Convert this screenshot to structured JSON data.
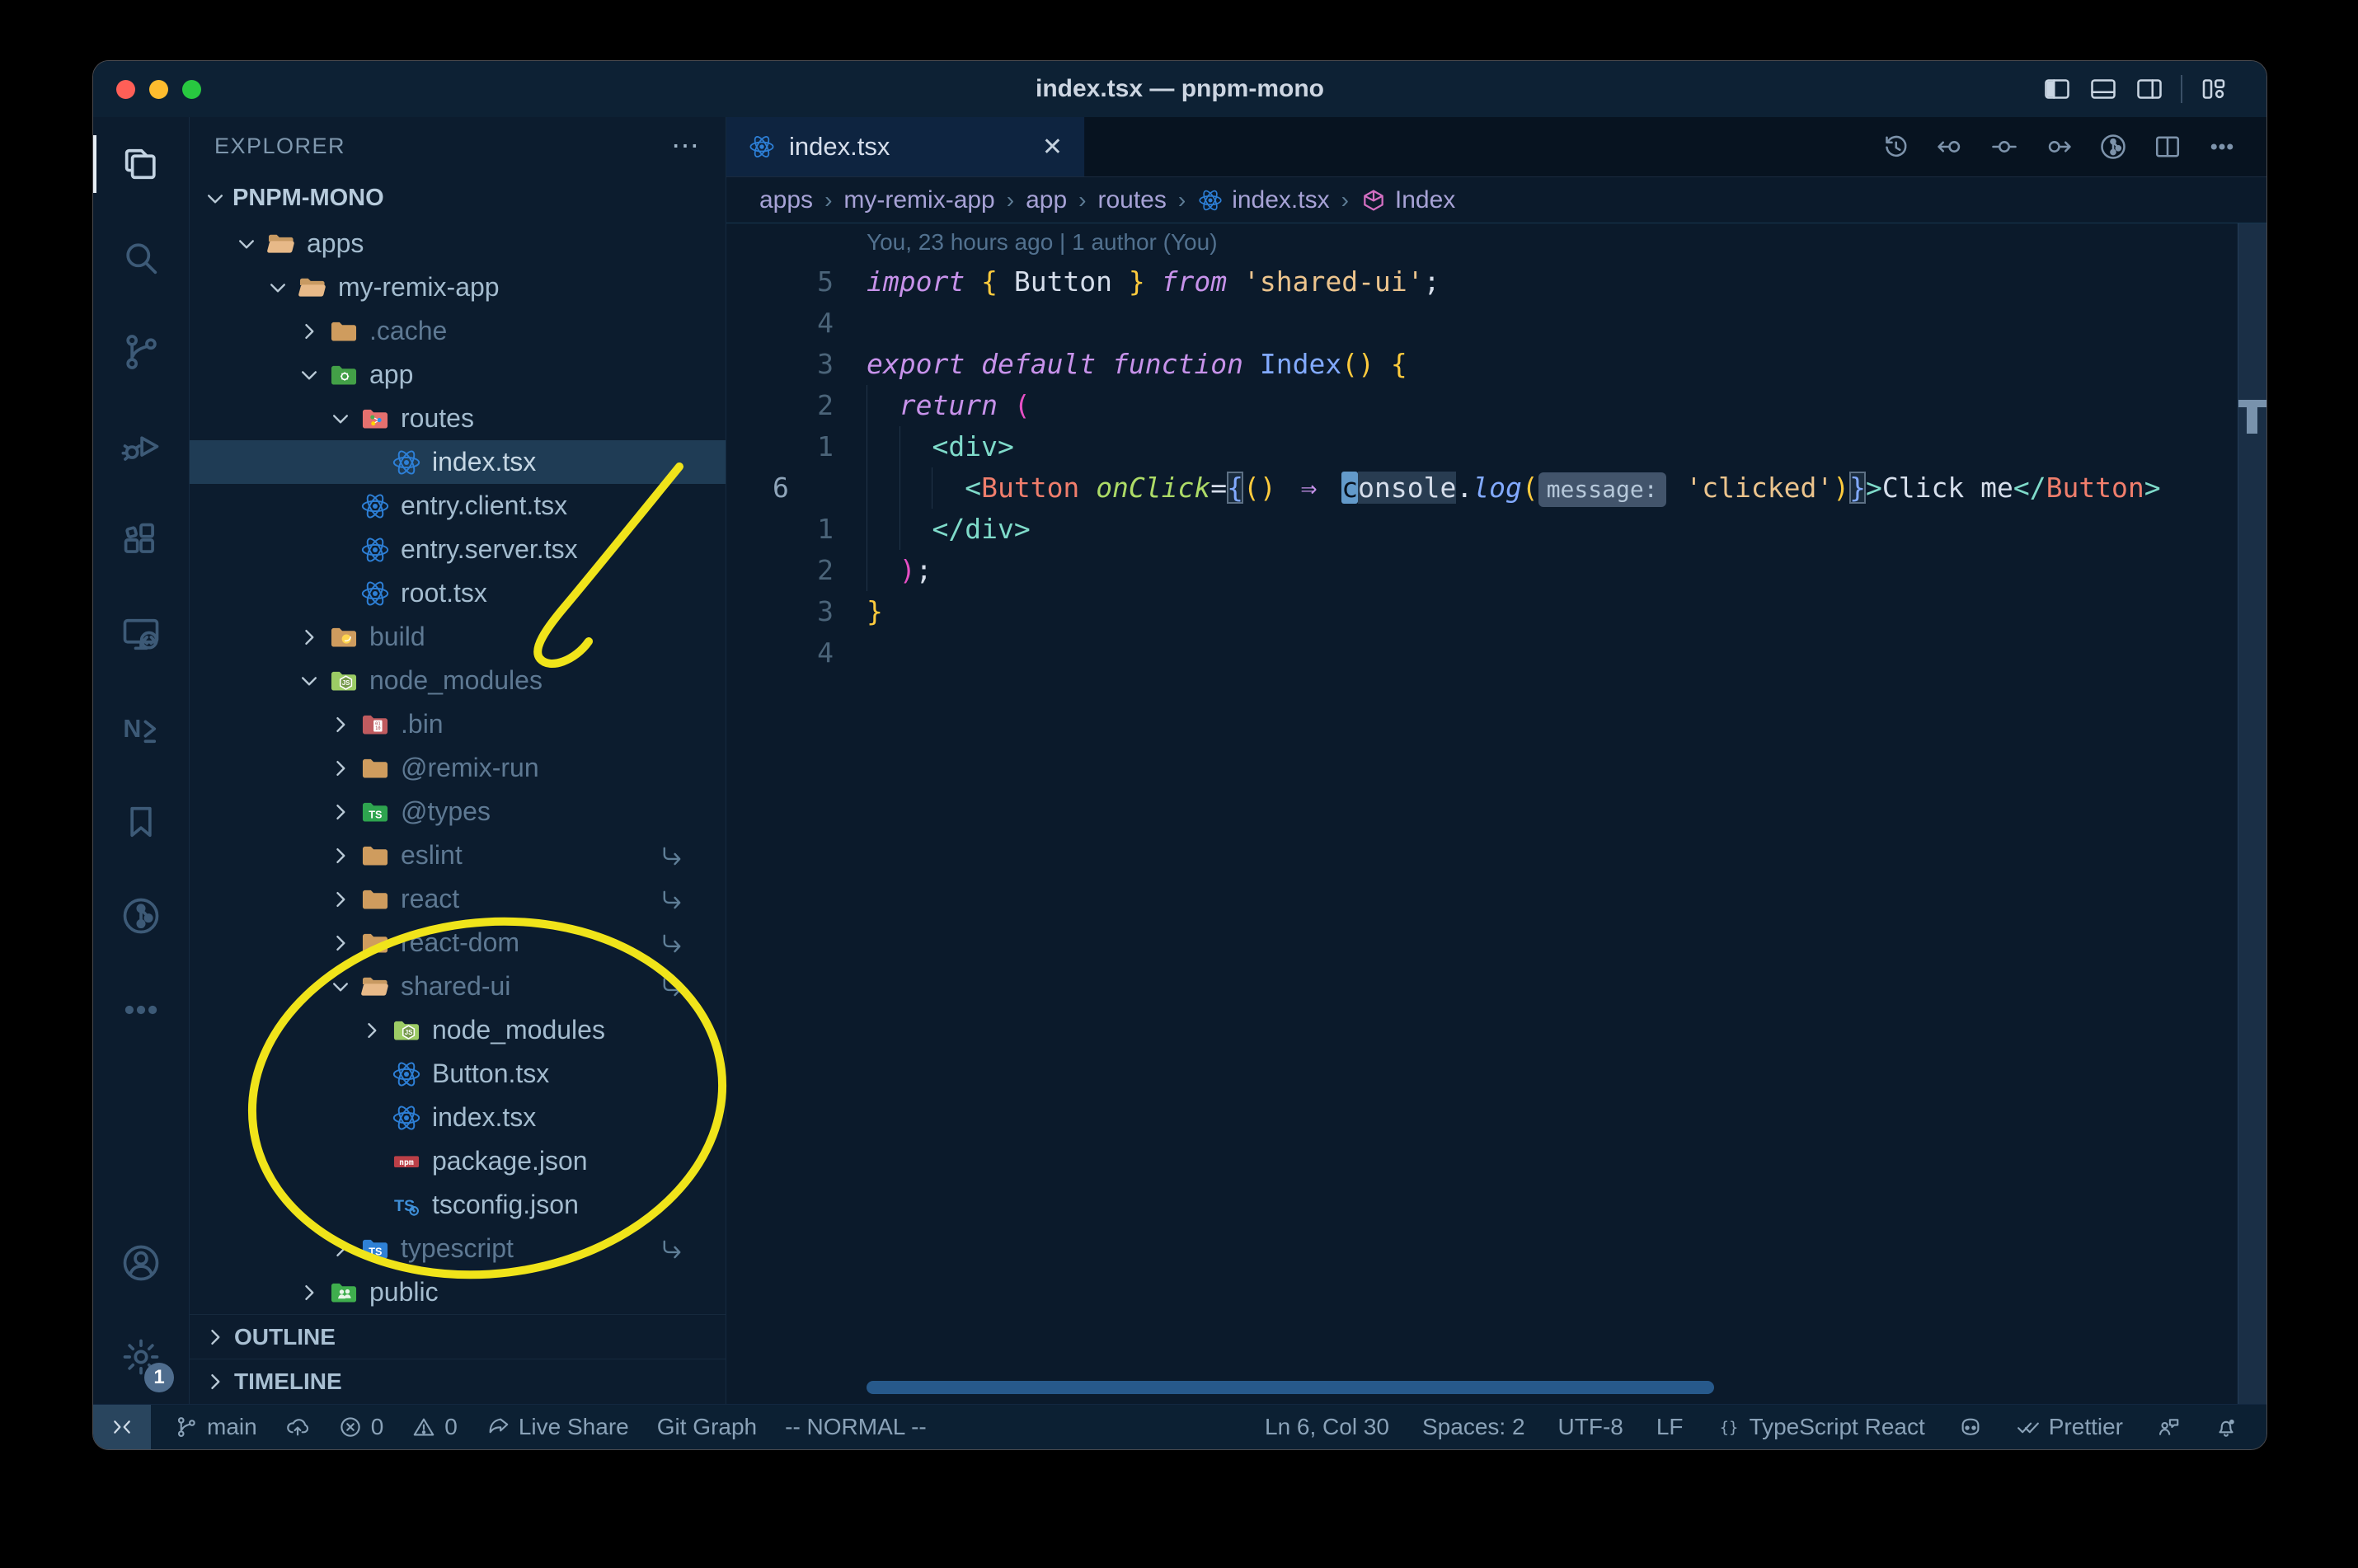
{
  "window": {
    "title": "index.tsx — pnpm-mono"
  },
  "titlebar": {
    "icons": [
      "panel-left-icon",
      "panel-bottom-icon",
      "panel-right-icon",
      "separator",
      "layout-icon"
    ]
  },
  "activity_bar": {
    "top": [
      {
        "id": "explorer",
        "icon": "files-icon",
        "active": true
      },
      {
        "id": "search",
        "icon": "search-icon"
      },
      {
        "id": "source-control",
        "icon": "source-control-icon"
      },
      {
        "id": "run-debug",
        "icon": "debug-icon"
      },
      {
        "id": "extensions",
        "icon": "extensions-icon"
      },
      {
        "id": "remote-explorer",
        "icon": "remote-explorer-icon"
      },
      {
        "id": "nx-console",
        "icon": "nx-icon"
      },
      {
        "id": "bookmarks",
        "icon": "bookmark-icon"
      },
      {
        "id": "git-graph",
        "icon": "git-graph-icon"
      },
      {
        "id": "more-views",
        "icon": "ellipsis-icon"
      }
    ],
    "bottom": [
      {
        "id": "accounts",
        "icon": "account-icon"
      },
      {
        "id": "settings",
        "icon": "gear-icon",
        "badge": "1"
      }
    ]
  },
  "sidebar": {
    "title": "EXPLORER",
    "more_label": "⋯",
    "project": {
      "label": "PNPM-MONO",
      "chevron": "down"
    },
    "tree": [
      {
        "label": "apps",
        "depth": 1,
        "icon": "folder-open-tan-icon",
        "chevron": "down"
      },
      {
        "label": "my-remix-app",
        "depth": 2,
        "icon": "folder-open-tan-icon",
        "chevron": "down"
      },
      {
        "label": ".cache",
        "depth": 3,
        "icon": "folder-tan-icon",
        "chevron": "right",
        "dim": true
      },
      {
        "label": "app",
        "depth": 3,
        "icon": "folder-app-icon",
        "chevron": "down"
      },
      {
        "label": "routes",
        "depth": 4,
        "icon": "folder-routes-icon",
        "chevron": "down"
      },
      {
        "label": "index.tsx",
        "depth": 5,
        "icon": "react-icon",
        "selected": true
      },
      {
        "label": "entry.client.tsx",
        "depth": 4,
        "icon": "react-icon"
      },
      {
        "label": "entry.server.tsx",
        "depth": 4,
        "icon": "react-icon"
      },
      {
        "label": "root.tsx",
        "depth": 4,
        "icon": "react-icon"
      },
      {
        "label": "build",
        "depth": 3,
        "icon": "folder-build-icon",
        "chevron": "right",
        "dim": true
      },
      {
        "label": "node_modules",
        "depth": 3,
        "icon": "folder-node-icon",
        "chevron": "down",
        "dim": true
      },
      {
        "label": ".bin",
        "depth": 4,
        "icon": "folder-bin-icon",
        "chevron": "right",
        "dim": true
      },
      {
        "label": "@remix-run",
        "depth": 4,
        "icon": "folder-tan-icon",
        "chevron": "right",
        "dim": true
      },
      {
        "label": "@types",
        "depth": 4,
        "icon": "folder-types-icon",
        "chevron": "right",
        "dim": true
      },
      {
        "label": "eslint",
        "depth": 4,
        "icon": "folder-tan-icon",
        "chevron": "right",
        "dim": true,
        "symlink": true
      },
      {
        "label": "react",
        "depth": 4,
        "icon": "folder-tan-icon",
        "chevron": "right",
        "dim": true,
        "symlink": true
      },
      {
        "label": "react-dom",
        "depth": 4,
        "icon": "folder-tan-icon",
        "chevron": "right",
        "dim": true,
        "symlink": true
      },
      {
        "label": "shared-ui",
        "depth": 4,
        "icon": "folder-open-tan-icon",
        "chevron": "down",
        "dim": true,
        "symlink": true
      },
      {
        "label": "node_modules",
        "depth": 5,
        "icon": "folder-node-icon",
        "chevron": "right"
      },
      {
        "label": "Button.tsx",
        "depth": 5,
        "icon": "react-icon"
      },
      {
        "label": "index.tsx",
        "depth": 5,
        "icon": "react-icon"
      },
      {
        "label": "package.json",
        "depth": 5,
        "icon": "npm-icon"
      },
      {
        "label": "tsconfig.json",
        "depth": 5,
        "icon": "tsconfig-icon"
      },
      {
        "label": "typescript",
        "depth": 4,
        "icon": "folder-ts-icon",
        "chevron": "right",
        "dim": true,
        "symlink": true
      },
      {
        "label": "public",
        "depth": 3,
        "icon": "folder-public-icon",
        "chevron": "right"
      }
    ],
    "panels": [
      {
        "label": "OUTLINE"
      },
      {
        "label": "TIMELINE"
      }
    ]
  },
  "editor": {
    "tab": {
      "label": "index.tsx",
      "icon": "react-icon",
      "close": "✕"
    },
    "actions": [
      "history-icon",
      "prev-change-icon",
      "change-icon",
      "next-change-icon",
      "git-graph-icon",
      "split-editor-icon",
      "ellipsis-icon"
    ],
    "breadcrumbs": [
      {
        "label": "apps"
      },
      {
        "label": "my-remix-app"
      },
      {
        "label": "app"
      },
      {
        "label": "routes"
      },
      {
        "label": "index.tsx",
        "icon": "react-icon"
      },
      {
        "label": "Index",
        "icon": "symbol-class-icon"
      }
    ],
    "breadcrumb_separator": "›",
    "blame": "You, 23 hours ago | 1 author (You)",
    "code_lines": [
      {
        "type": "blame"
      },
      {
        "num": "5",
        "indent": 0,
        "seg": [
          [
            "import",
            "kw"
          ],
          [
            " ",
            "pl"
          ],
          [
            "{",
            "gold"
          ],
          [
            " Button ",
            "pl"
          ],
          [
            "}",
            "gold"
          ],
          [
            " ",
            "pl"
          ],
          [
            "from",
            "kw"
          ],
          [
            " ",
            "pl"
          ],
          [
            "'shared-ui'",
            "str"
          ],
          [
            ";",
            "pl"
          ]
        ]
      },
      {
        "num": "4",
        "indent": 0,
        "seg": []
      },
      {
        "num": "3",
        "indent": 0,
        "seg": [
          [
            "export",
            "kw"
          ],
          [
            " ",
            "pl"
          ],
          [
            "default",
            "kw"
          ],
          [
            " ",
            "pl"
          ],
          [
            "function",
            "kw"
          ],
          [
            " ",
            "pl"
          ],
          [
            "Index",
            "fn"
          ],
          [
            "(",
            "gold"
          ],
          [
            ")",
            "gold"
          ],
          [
            " ",
            "pl"
          ],
          [
            "{",
            "gold"
          ]
        ]
      },
      {
        "num": "2",
        "indent": 2,
        "seg": [
          [
            "return",
            "kw"
          ],
          [
            " ",
            "pl"
          ],
          [
            "(",
            "pink"
          ]
        ]
      },
      {
        "num": "1",
        "indent": 4,
        "seg": [
          [
            "<div>",
            "tag"
          ]
        ]
      },
      {
        "num": "6",
        "current": true,
        "indent": 6,
        "seg": [
          [
            "<",
            "tag"
          ],
          [
            "Button",
            "comp"
          ],
          [
            " ",
            "pl"
          ],
          [
            "onClick",
            "attr"
          ],
          [
            "=",
            "pl"
          ],
          [
            "{",
            "bb"
          ],
          [
            "(",
            "gold"
          ],
          [
            ")",
            "gold"
          ],
          [
            " ",
            "pl"
          ],
          [
            "⇒",
            "arrow"
          ],
          [
            " ",
            "pl"
          ],
          [
            "c",
            "cursor"
          ],
          [
            "onsole",
            "word"
          ],
          [
            ".",
            "pl"
          ],
          [
            "log",
            "fni"
          ],
          [
            "(",
            "gold"
          ],
          [
            "message:",
            "inlay"
          ],
          [
            " ",
            "pl"
          ],
          [
            "'clicked'",
            "str"
          ],
          [
            ")",
            "gold"
          ],
          [
            "}",
            "bb"
          ],
          [
            ">",
            "tag"
          ],
          [
            "Click me",
            "pl"
          ],
          [
            "</",
            "tag"
          ],
          [
            "Button",
            "comp"
          ],
          [
            ">",
            "tag"
          ]
        ]
      },
      {
        "num": "1",
        "indent": 4,
        "seg": [
          [
            "</div>",
            "tag"
          ]
        ]
      },
      {
        "num": "2",
        "indent": 2,
        "seg": [
          [
            ")",
            "pink"
          ],
          [
            ";",
            "pl"
          ]
        ]
      },
      {
        "num": "3",
        "indent": 0,
        "seg": [
          [
            "}",
            "gold"
          ]
        ]
      },
      {
        "num": "4",
        "indent": 0,
        "seg": []
      }
    ]
  },
  "status_bar": {
    "remote_icon": "remote-window-icon",
    "left": [
      {
        "icon": "branch-icon",
        "label": "main"
      },
      {
        "icon": "cloud-upload-icon",
        "label": ""
      },
      {
        "icon": "error-icon",
        "label": "0"
      },
      {
        "icon": "warning-icon",
        "label": "0"
      },
      {
        "icon": "live-share-icon",
        "label": "Live Share"
      },
      {
        "label": "Git Graph"
      },
      {
        "label": "-- NORMAL --"
      }
    ],
    "right": [
      {
        "label": "Ln 6, Col 30"
      },
      {
        "label": "Spaces: 2"
      },
      {
        "label": "UTF-8"
      },
      {
        "label": "LF"
      },
      {
        "icon": "braces-icon",
        "label": "TypeScript React"
      },
      {
        "icon": "copilot-icon",
        "label": ""
      },
      {
        "icon": "prettier-icon",
        "label": "Prettier"
      },
      {
        "icon": "feedback-icon",
        "label": ""
      },
      {
        "icon": "bell-dot-icon",
        "label": ""
      }
    ]
  },
  "annotations": {
    "color": "#f0e41a",
    "arrow_target": "node_modules",
    "ellipse_target": "shared-ui package files"
  },
  "colors": {
    "editor_bg": "#0b1a2b",
    "sidebar_bg": "#0c1c2e",
    "selection_row": "#1f3c55",
    "keyword": "#c792ea",
    "string": "#ecc48d",
    "tag": "#7fdbca",
    "component": "#f07e6c",
    "attribute": "#addb67",
    "function": "#82aaff",
    "brace_gold": "#ffcb3d",
    "annotation_yellow": "#f0e41a"
  }
}
